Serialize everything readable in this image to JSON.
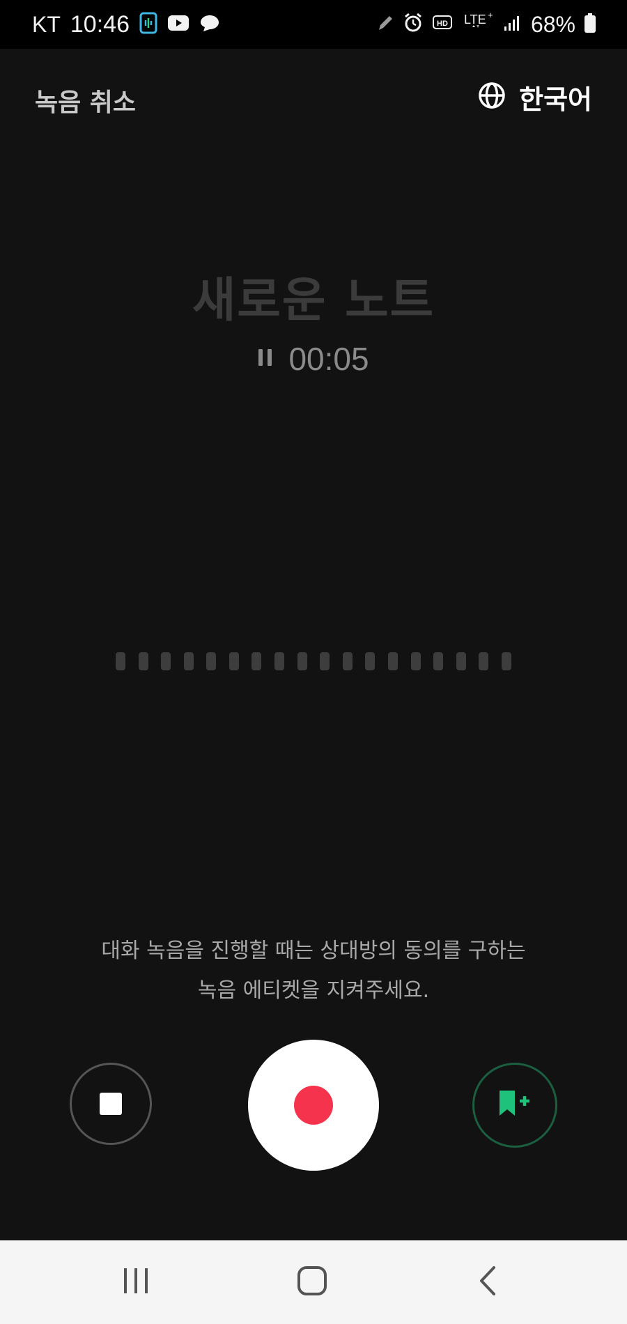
{
  "status_bar": {
    "carrier": "KT",
    "time": "10:46",
    "battery_percent": "68%",
    "icons_left": [
      "voice-recorder-app-icon",
      "youtube-icon",
      "chat-bubble-icon"
    ],
    "icons_right": [
      "pen-icon",
      "alarm-icon",
      "hd-icon",
      "lte-plus-icon",
      "signal-icon",
      "battery-icon"
    ]
  },
  "header": {
    "cancel_label": "녹음 취소",
    "language_label": "한국어",
    "language_icon": "globe-icon"
  },
  "recording": {
    "title": "새로운 노트",
    "elapsed": "00:05",
    "status_icon": "pause-icon",
    "waveform_bar_count": 18
  },
  "notice": {
    "line1": "대화 녹음을 진행할 때는 상대방의 동의를 구하는",
    "line2": "녹음 에티켓을 지켜주세요."
  },
  "controls": {
    "stop_icon": "stop-icon",
    "record_icon": "record-icon",
    "bookmark_icon": "bookmark-add-icon"
  },
  "navigation": {
    "recents_icon": "recent-apps-icon",
    "home_icon": "home-icon",
    "back_icon": "back-icon"
  },
  "colors": {
    "background": "#121212",
    "record_red": "#f5334c",
    "bookmark_green": "#1fc27a",
    "nav_background": "#f5f5f5"
  }
}
